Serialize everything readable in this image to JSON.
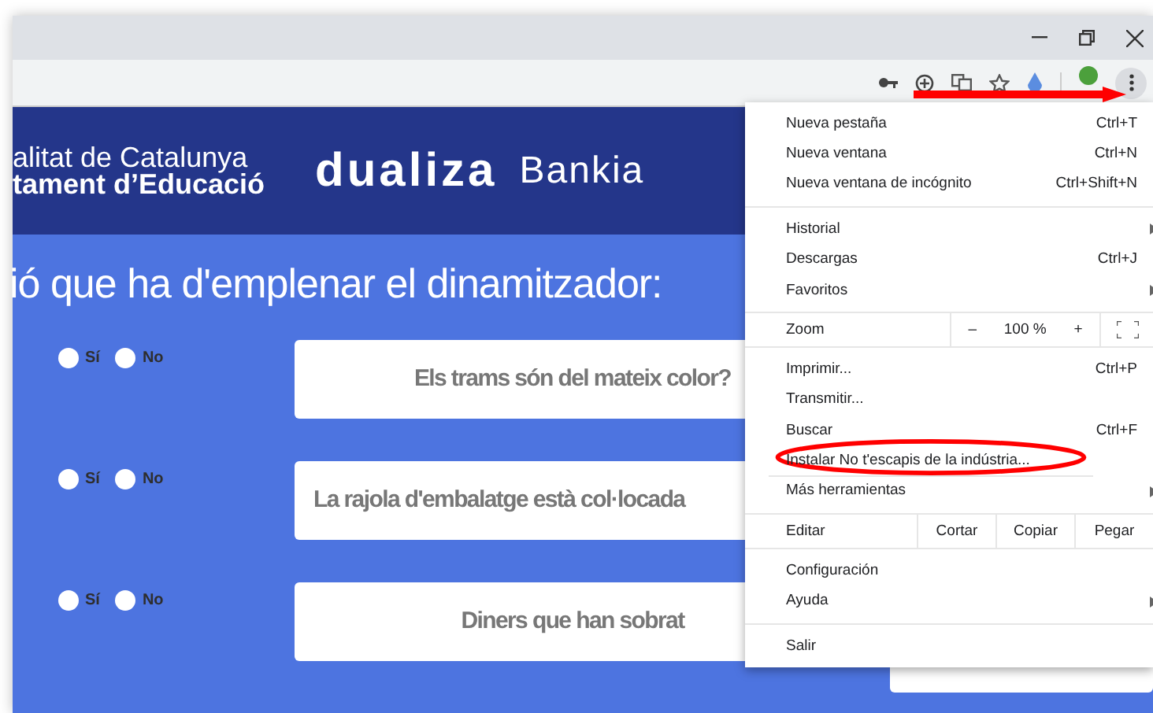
{
  "header": {
    "org_line_1": "alitat de Catalunya",
    "org_line_2": "tament d’Educació",
    "logo_1": "dualiza",
    "logo_2": "Bankia"
  },
  "heading": "ió que ha d'emplenar el dinamitzador:",
  "questions": [
    {
      "text": "Els trams són del mateix color?",
      "options": [
        {
          "label": "Sí",
          "checked": false
        },
        {
          "label": "No",
          "checked": false
        }
      ]
    },
    {
      "text": "La rajola d'embalatge està col·locada",
      "options": [
        {
          "label": "Sí",
          "checked": false
        },
        {
          "label": "No",
          "checked": false
        }
      ]
    },
    {
      "text": "Diners que han sobrat",
      "options": [
        {
          "label": "Sí",
          "checked": false
        },
        {
          "label": "No",
          "checked": false
        }
      ]
    }
  ],
  "menu": {
    "groups": [
      {
        "kind": "items",
        "items": [
          {
            "label": "Nueva pestaña",
            "shortcut": "Ctrl+T"
          },
          {
            "label": "Nueva ventana",
            "shortcut": "Ctrl+N"
          },
          {
            "label": "Nueva ventana de incógnito",
            "shortcut": "Ctrl+Shift+N"
          }
        ]
      },
      {
        "kind": "items",
        "items": [
          {
            "label": "Historial",
            "submenu": true
          },
          {
            "label": "Descargas",
            "shortcut": "Ctrl+J"
          },
          {
            "label": "Favoritos",
            "submenu": true
          }
        ]
      },
      {
        "kind": "zoom",
        "label": "Zoom",
        "minus": "–",
        "value": "100 %",
        "plus": "+"
      },
      {
        "kind": "items",
        "items": [
          {
            "label": "Imprimir...",
            "shortcut": "Ctrl+P"
          },
          {
            "label": "Transmitir..."
          },
          {
            "label": "Buscar",
            "shortcut": "Ctrl+F"
          },
          {
            "label": "Instalar No t'escapis de la indústria..."
          },
          {
            "label": "Más herramientas",
            "submenu": true
          }
        ]
      },
      {
        "kind": "edit",
        "label": "Editar",
        "buttons": [
          "Cortar",
          "Copiar",
          "Pegar"
        ]
      },
      {
        "kind": "items",
        "items": [
          {
            "label": "Configuración"
          },
          {
            "label": "Ayuda",
            "submenu": true
          }
        ]
      },
      {
        "kind": "items",
        "items": [
          {
            "label": "Salir"
          }
        ]
      }
    ]
  }
}
